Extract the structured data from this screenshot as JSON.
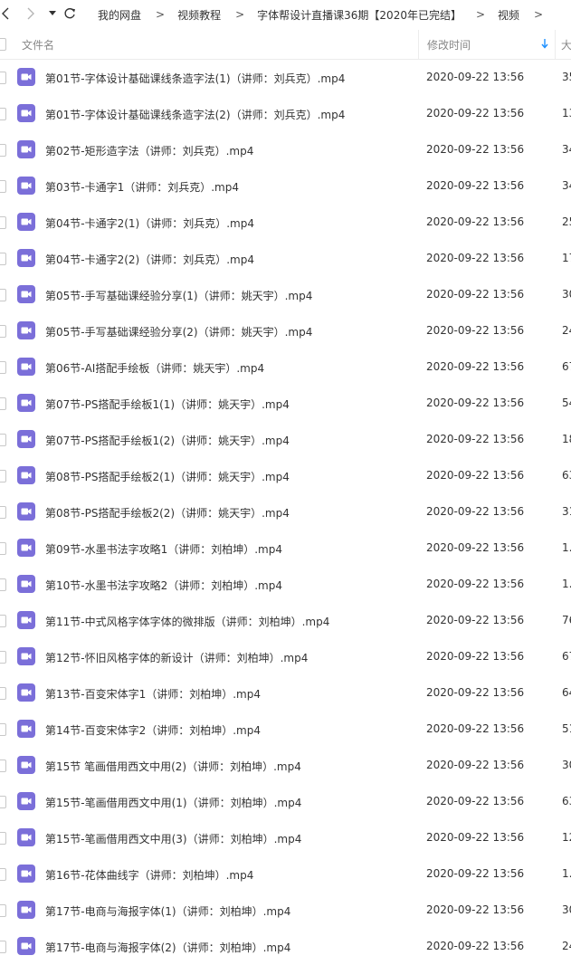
{
  "breadcrumb": {
    "items": [
      "我的网盘",
      "视频教程",
      "字体帮设计直播课36期【2020年已完结】",
      "视频"
    ],
    "separator": ">"
  },
  "nav": {
    "back_icon": "chevron-left-icon",
    "forward_icon": "chevron-right-icon",
    "dropdown_icon": "caret-down-icon",
    "refresh_icon": "refresh-icon"
  },
  "header": {
    "name_label": "文件名",
    "time_label": "修改时间",
    "size_label": "大",
    "sort_icon": "sort-down-arrow-icon",
    "sort_color": "#1e90ff"
  },
  "colors": {
    "video_icon": "#7b6fd9"
  },
  "files": [
    {
      "name": "第01节-字体设计基础课线条造字法(1)（讲师：刘兵克）.mp4",
      "time": "2020-09-22 13:56",
      "size": "35"
    },
    {
      "name": "第01节-字体设计基础课线条造字法(2)（讲师：刘兵克）.mp4",
      "time": "2020-09-22 13:56",
      "size": "13"
    },
    {
      "name": "第02节-矩形造字法（讲师：刘兵克）.mp4",
      "time": "2020-09-22 13:56",
      "size": "34"
    },
    {
      "name": "第03节-卡通字1（讲师：刘兵克）.mp4",
      "time": "2020-09-22 13:56",
      "size": "34"
    },
    {
      "name": "第04节-卡通字2(1)（讲师：刘兵克）.mp4",
      "time": "2020-09-22 13:56",
      "size": "25"
    },
    {
      "name": "第04节-卡通字2(2)（讲师：刘兵克）.mp4",
      "time": "2020-09-22 13:56",
      "size": "17"
    },
    {
      "name": "第05节-手写基础课经验分享(1)（讲师：姚天宇）.mp4",
      "time": "2020-09-22 13:56",
      "size": "30"
    },
    {
      "name": "第05节-手写基础课经验分享(2)（讲师：姚天宇）.mp4",
      "time": "2020-09-22 13:56",
      "size": "24"
    },
    {
      "name": "第06节-AI搭配手绘板（讲师：姚天宇）.mp4",
      "time": "2020-09-22 13:56",
      "size": "67"
    },
    {
      "name": "第07节-PS搭配手绘板1(1)（讲师：姚天宇）.mp4",
      "time": "2020-09-22 13:56",
      "size": "54"
    },
    {
      "name": "第07节-PS搭配手绘板1(2)（讲师：姚天宇）.mp4",
      "time": "2020-09-22 13:56",
      "size": "18"
    },
    {
      "name": "第08节-PS搭配手绘板2(1)（讲师：姚天宇）.mp4",
      "time": "2020-09-22 13:56",
      "size": "63"
    },
    {
      "name": "第08节-PS搭配手绘板2(2)（讲师：姚天宇）.mp4",
      "time": "2020-09-22 13:56",
      "size": "31"
    },
    {
      "name": "第09节-水墨书法字攻略1（讲师：刘柏坤）.mp4",
      "time": "2020-09-22 13:56",
      "size": "1."
    },
    {
      "name": "第10节-水墨书法字攻略2（讲师：刘柏坤）.mp4",
      "time": "2020-09-22 13:56",
      "size": "1."
    },
    {
      "name": "第11节-中式风格字体字体的微排版（讲师：刘柏坤）.mp4",
      "time": "2020-09-22 13:56",
      "size": "76"
    },
    {
      "name": "第12节-怀旧风格字体的新设计（讲师：刘柏坤）.mp4",
      "time": "2020-09-22 13:56",
      "size": "67"
    },
    {
      "name": "第13节-百变宋体字1（讲师：刘柏坤）.mp4",
      "time": "2020-09-22 13:56",
      "size": "64"
    },
    {
      "name": "第14节-百变宋体字2（讲师：刘柏坤）.mp4",
      "time": "2020-09-22 13:56",
      "size": "51"
    },
    {
      "name": "第15节 笔画借用西文中用(2)（讲师：刘柏坤）.mp4",
      "time": "2020-09-22 13:56",
      "size": "30"
    },
    {
      "name": "第15节-笔画借用西文中用(1)（讲师：刘柏坤）.mp4",
      "time": "2020-09-22 13:56",
      "size": "63"
    },
    {
      "name": "第15节-笔画借用西文中用(3)（讲师：刘柏坤）.mp4",
      "time": "2020-09-22 13:56",
      "size": "12"
    },
    {
      "name": "第16节-花体曲线字（讲师：刘柏坤）.mp4",
      "time": "2020-09-22 13:56",
      "size": "1."
    },
    {
      "name": "第17节-电商与海报字体(1)（讲师：刘柏坤）.mp4",
      "time": "2020-09-22 13:56",
      "size": "30"
    },
    {
      "name": "第17节-电商与海报字体(2)（讲师：刘柏坤）.mp4",
      "time": "2020-09-22 13:56",
      "size": "24"
    }
  ]
}
